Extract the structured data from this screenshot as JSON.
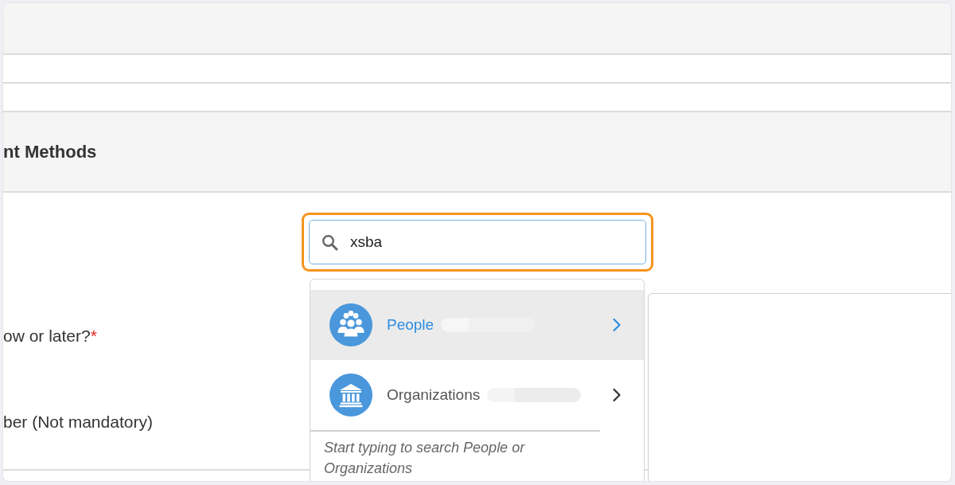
{
  "section": {
    "title": "nt Methods"
  },
  "form": {
    "fields": [
      {
        "label": "ow or later?",
        "required_mark": "*"
      },
      {
        "label": "ber (Not mandatory)"
      }
    ]
  },
  "search": {
    "value": "xsba",
    "focused": true
  },
  "dropdown": {
    "items": [
      {
        "kind": "people",
        "label": "People",
        "selected": true,
        "redacted": true
      },
      {
        "kind": "organization",
        "label": "Organizations",
        "selected": false,
        "redacted": true
      }
    ],
    "hint": "Start typing to search People or Organizations"
  }
}
